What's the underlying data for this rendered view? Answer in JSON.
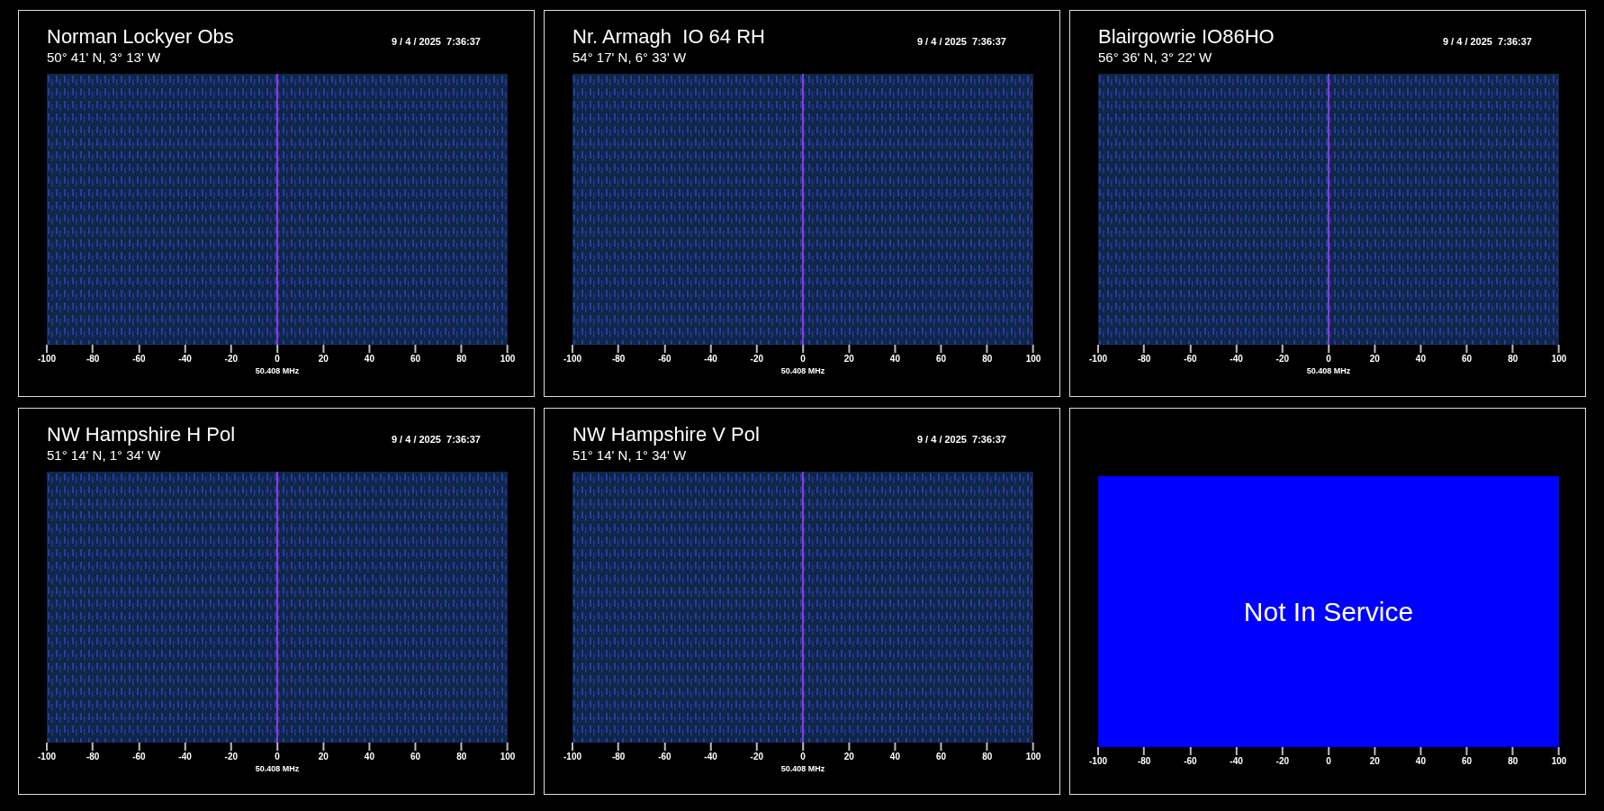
{
  "panels": [
    {
      "kind": "spectrogram",
      "title": "Norman Lockyer Obs",
      "timestamp": "9 / 4 / 2025  7:36:37",
      "location": "50° 41' N, 3° 13' W",
      "axis_ticks": [
        "-100",
        "-80",
        "-60",
        "-40",
        "-20",
        "0",
        "20",
        "40",
        "60",
        "80",
        "100"
      ],
      "axis_label": "50.408 MHz"
    },
    {
      "kind": "spectrogram",
      "title": "Nr. Armagh  IO 64 RH",
      "timestamp": "9 / 4 / 2025  7:36:37",
      "location": "54° 17' N, 6° 33' W",
      "axis_ticks": [
        "-100",
        "-80",
        "-60",
        "-40",
        "-20",
        "0",
        "20",
        "40",
        "60",
        "80",
        "100"
      ],
      "axis_label": "50.408 MHz"
    },
    {
      "kind": "spectrogram",
      "title": "Blairgowrie IO86HO",
      "timestamp": "9 / 4 / 2025  7:36:37",
      "location": "56° 36' N, 3° 22' W",
      "axis_ticks": [
        "-100",
        "-80",
        "-60",
        "-40",
        "-20",
        "0",
        "20",
        "40",
        "60",
        "80",
        "100"
      ],
      "axis_label": "50.408 MHz"
    },
    {
      "kind": "spectrogram",
      "title": "NW Hampshire H Pol",
      "timestamp": "9 / 4 / 2025  7:36:37",
      "location": "51° 14' N, 1° 34' W",
      "axis_ticks": [
        "-100",
        "-80",
        "-60",
        "-40",
        "-20",
        "0",
        "20",
        "40",
        "60",
        "80",
        "100"
      ],
      "axis_label": "50.408 MHz"
    },
    {
      "kind": "spectrogram",
      "title": "NW Hampshire V Pol",
      "timestamp": "9 / 4 / 2025  7:36:37",
      "location": "51° 14' N, 1° 34' W",
      "axis_ticks": [
        "-100",
        "-80",
        "-60",
        "-40",
        "-20",
        "0",
        "20",
        "40",
        "60",
        "80",
        "100"
      ],
      "axis_label": "50.408 MHz"
    },
    {
      "kind": "offline",
      "message": "Not In Service",
      "axis_ticks": [
        "-100",
        "-80",
        "-60",
        "-40",
        "-20",
        "0",
        "20",
        "40",
        "60",
        "80",
        "100"
      ]
    }
  ]
}
